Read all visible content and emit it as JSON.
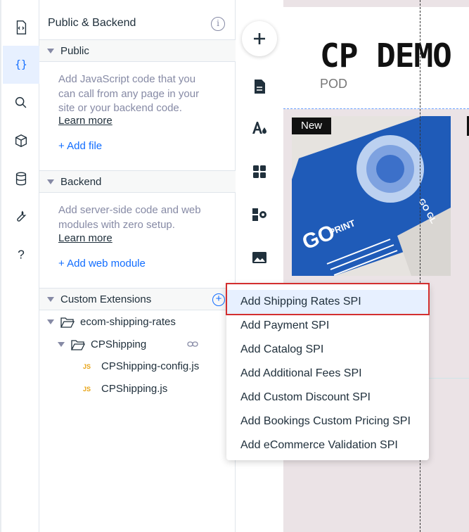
{
  "panel": {
    "title": "Public & Backend",
    "public": {
      "label": "Public",
      "description": "Add JavaScript code that you can call from any page in your site or your backend code.",
      "learn_more": "Learn more",
      "add": "+ Add file"
    },
    "backend": {
      "label": "Backend",
      "description": "Add server-side code and web modules with zero setup.",
      "learn_more": "Learn more",
      "add": "+ Add web module"
    },
    "custom_extensions": {
      "label": "Custom Extensions",
      "tree": {
        "root_folder": "ecom-shipping-rates",
        "sub_folder": "CPShipping",
        "files": [
          {
            "badge": "JS",
            "name": "CPShipping-config.js"
          },
          {
            "badge": "JS",
            "name": "CPShipping.js"
          }
        ]
      }
    }
  },
  "rail_icons": [
    "page-code-icon",
    "braces-icon",
    "search-icon",
    "package-icon",
    "database-icon",
    "wrench-icon",
    "help-icon"
  ],
  "toolbar_icons": [
    "add-icon",
    "pages-icon",
    "theme-icon",
    "apps-icon",
    "extensions-icon",
    "media-icon"
  ],
  "canvas": {
    "brand": "CP DEMO",
    "brand_sub": "POD",
    "badge": "New"
  },
  "menu": {
    "items": [
      "Add Shipping Rates SPI",
      "Add Payment SPI",
      "Add Catalog SPI",
      "Add Additional Fees SPI",
      "Add Custom Discount SPI",
      "Add Bookings Custom Pricing SPI",
      "Add eCommerce Validation SPI"
    ],
    "highlighted_index": 0
  },
  "colors": {
    "accent": "#116dff",
    "highlight": "#e7f0ff",
    "annotation": "#d32f2f"
  }
}
